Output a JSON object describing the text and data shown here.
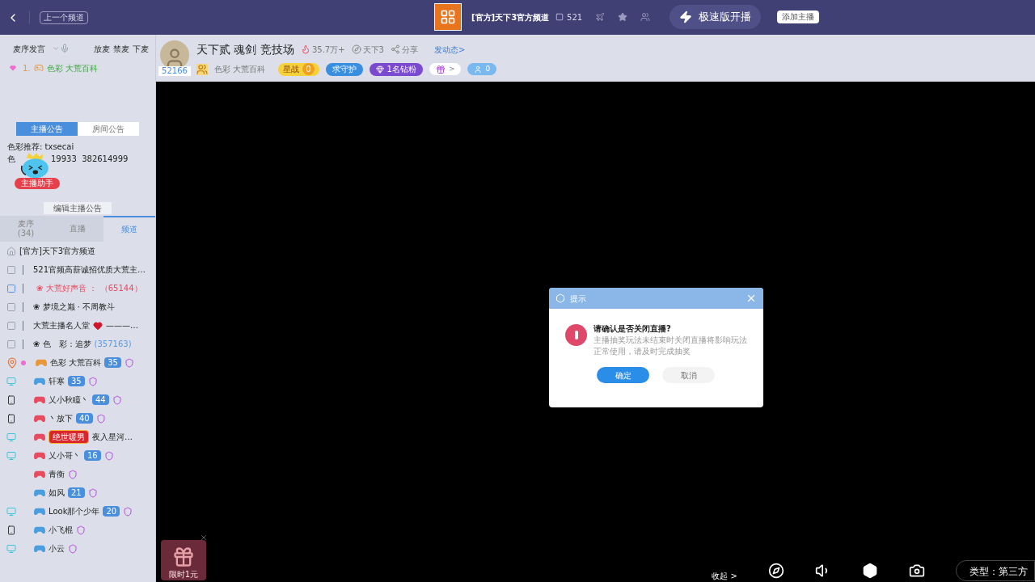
{
  "top_bar": {
    "prev_channel": "上一个频道",
    "channel_name": "[官方]天下3官方频道",
    "viewer_count": "521",
    "speed_button": "极速版开播",
    "add_anchor": "添加主播"
  },
  "mic": {
    "mode": "麦序发言",
    "actions": [
      "放麦",
      "禁麦",
      "下麦"
    ],
    "queue": [
      {
        "index": "1.",
        "name": "色彩 大荒百科"
      }
    ]
  },
  "notice": {
    "tabs": [
      {
        "label": "主播公告",
        "selected": true
      },
      {
        "label": "房间公告",
        "selected": false
      }
    ],
    "lines": [
      [
        "色彩推荐: txsecai"
      ],
      [
        "色",
        "19933  382614999"
      ]
    ],
    "assistant": "主播助手",
    "edit_button": "编辑主播公告"
  },
  "list_tabs": [
    {
      "label": "麦序",
      "count": "(34)",
      "selected": false
    },
    {
      "label": "直播",
      "selected": false
    },
    {
      "label": "频道",
      "selected": true
    }
  ],
  "tree": [
    {
      "kind": "channel",
      "name": "[官方]天下3官方频道",
      "children": [
        {
          "kind": "channel",
          "name": "521官频高薪诚招优质大荒主…",
          "highlight": false
        },
        {
          "kind": "channel",
          "name": "❀ 大荒好声音 ：",
          "count": "（65144）",
          "highlight": true
        },
        {
          "kind": "channel",
          "name": "❀ 梦境之巅 · 不周教斗",
          "highlight": false
        },
        {
          "kind": "channel",
          "name": "大荒主播名人堂",
          "decor": "———…",
          "highlight": false
        },
        {
          "kind": "channel",
          "name": "❀ 色　彩：追梦",
          "count": "(357163)",
          "highlight": false,
          "children": [
            {
              "kind": "user",
              "device": {
                "kind": "pin"
              },
              "online": true,
              "color": "#e8973a",
              "name": "色彩 大荒百科",
              "level": "35"
            },
            {
              "kind": "user",
              "device": {
                "kind": "pc"
              },
              "online": false,
              "color": "#4a9ee0",
              "name": "轩寒",
              "level": "35"
            },
            {
              "kind": "user",
              "device": {
                "kind": "phone"
              },
              "online": false,
              "color": "#e84a5f",
              "name": "乂小秋瞳丶",
              "level": "44"
            },
            {
              "kind": "user",
              "device": {
                "kind": "phone"
              },
              "online": false,
              "color": "#e84a5f",
              "name": "丶放下",
              "level": "40"
            },
            {
              "kind": "user",
              "device": {
                "kind": "pc"
              },
              "online": false,
              "color": "#e84a5f",
              "title": "绝世暖男",
              "name": "夜入星河…"
            },
            {
              "kind": "user",
              "device": {
                "kind": "pc"
              },
              "online": false,
              "color": "#e84a5f",
              "name": "乂小哥丶",
              "level": "16"
            },
            {
              "kind": "user",
              "online": false,
              "color": "#e84a5f",
              "name": "青衡"
            },
            {
              "kind": "user",
              "online": false,
              "color": "#4a9ee0",
              "name": "如风",
              "level": "21"
            },
            {
              "kind": "user",
              "device": {
                "kind": "pc"
              },
              "online": false,
              "color": "#4a9ee0",
              "name": "Look那个少年",
              "level": "20"
            },
            {
              "kind": "user",
              "device": {
                "kind": "phone"
              },
              "online": false,
              "color": "#4a9ee0",
              "name": "小飞棍"
            },
            {
              "kind": "user",
              "device": {
                "kind": "pc"
              },
              "online": false,
              "color": "#4a9ee0",
              "name": "小云"
            }
          ]
        }
      ]
    }
  ],
  "room": {
    "anchor_id": "52166",
    "title": "天下贰 魂剑 竞技场",
    "heat": "35.7万+",
    "game": "天下3",
    "share": "分享",
    "post": "发动态>",
    "anchor_name": "色彩 大荒百科",
    "star_battle": "星战",
    "star_count": "0",
    "guard": "求守护",
    "diamond_fans": "1名钻粉",
    "gift_more": ">",
    "fans": "0"
  },
  "dialog": {
    "title": "提示",
    "heading": "请确认是否关闭直播?",
    "body": "主播抽奖玩法未结束时关闭直播将影响玩法正常使用，请及时完成抽奖",
    "confirm": "确定",
    "cancel": "取消"
  },
  "player": {
    "gift_label": "限时1元",
    "collapse": "收起 >",
    "type_label": "类型：第三方"
  }
}
